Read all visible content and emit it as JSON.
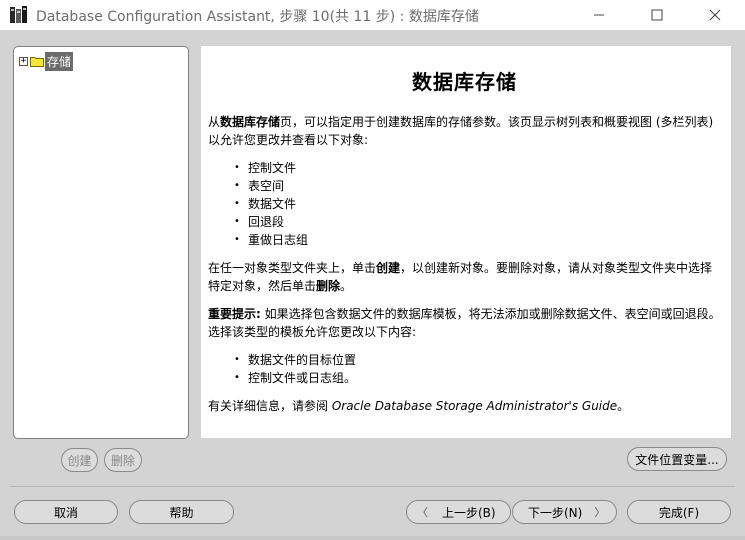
{
  "window": {
    "title": "Database Configuration Assistant, 步骤 10(共 11 步) : 数据库存储",
    "minimize": "—",
    "maximize": "☐",
    "close": "✕"
  },
  "tree": {
    "expander": "+",
    "root_label": "存储"
  },
  "content": {
    "title": "数据库存储",
    "intro_1": "从",
    "intro_bold": "数据库存储",
    "intro_2": "页，可以指定用于创建数据库的存储参数。该页显示树列表和概要视图 (多栏列表) 以允许您更改并查看以下对象:",
    "objects": [
      "控制文件",
      "表空间",
      "数据文件",
      "回退段",
      "重做日志组"
    ],
    "create_1": "在任一对象类型文件夹上，单击",
    "create_bold": "创建",
    "create_2": "，以创建新对象。要删除对象，请从对象类型文件夹中选择特定对象，然后单击",
    "delete_bold": "删除",
    "create_3": "。",
    "important_bold": "重要提示:",
    "important_text": " 如果选择包含数据文件的数据库模板，将无法添加或删除数据文件、表空间或回退段。选择该类型的模板允许您更改以下内容:",
    "changes": [
      "数据文件的目标位置",
      "控制文件或日志组。"
    ],
    "more_1": "有关详细信息，请参阅 ",
    "more_italic": "Oracle Database Storage Administrator's Guide",
    "more_2": "。"
  },
  "buttons": {
    "create": "创建",
    "delete": "删除",
    "file_location_vars": "文件位置变量...",
    "cancel": "取消",
    "help": "帮助",
    "back": "上一步(B)",
    "next": "下一步(N)",
    "finish": "完成(F)",
    "back_arrow": "〈",
    "next_arrow": "〉"
  }
}
